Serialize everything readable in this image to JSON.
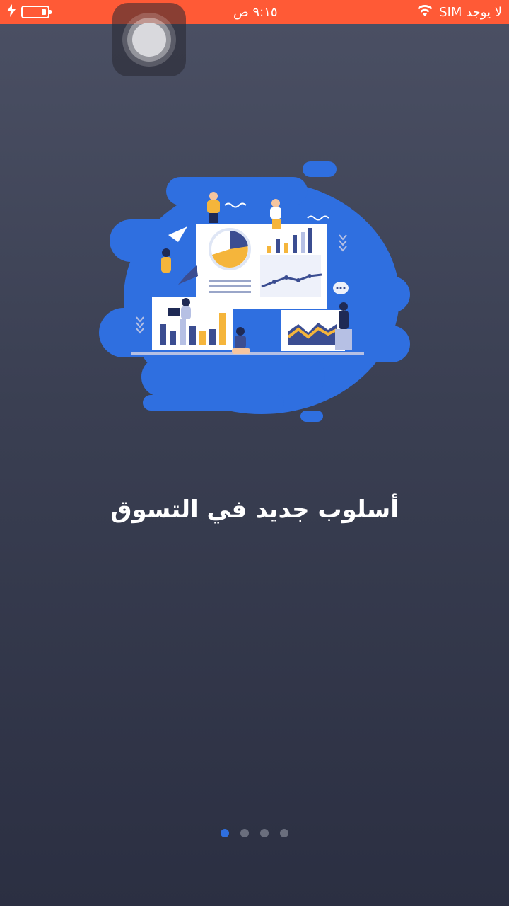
{
  "status_bar": {
    "carrier": "لا يوجد SIM",
    "time": "٩:١٥ ص",
    "battery_icon": "battery-icon",
    "charging_icon": "lightning-icon",
    "wifi_icon": "wifi-icon",
    "color": "#ff5a36"
  },
  "onboarding": {
    "title": "أسلوب جديد في التسوق",
    "illustration": "marketing-analytics-illustration",
    "page_indicator": {
      "count": 4,
      "active_index": 0,
      "active_color": "#2f6fe0"
    }
  }
}
